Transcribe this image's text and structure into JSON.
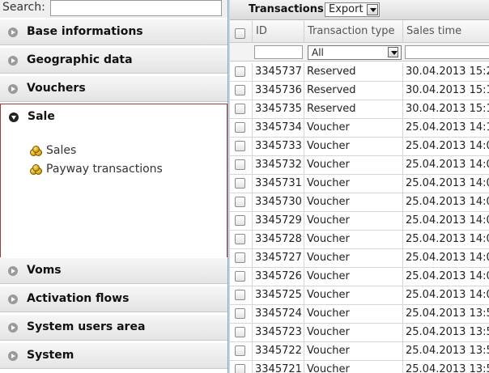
{
  "search": {
    "label": "Search:",
    "value": "",
    "placeholder": ""
  },
  "accordion": {
    "top_sections": [
      {
        "label": "Base informations"
      },
      {
        "label": "Geographic data"
      },
      {
        "label": "Vouchers"
      }
    ],
    "open_section": {
      "label": "Sale",
      "items": [
        {
          "label": "Sales",
          "icon": "coins-icon"
        },
        {
          "label": "Payway transactions",
          "icon": "coins-icon"
        }
      ]
    },
    "bottom_sections": [
      {
        "label": "Voms"
      },
      {
        "label": "Activation flows"
      },
      {
        "label": "System users area"
      },
      {
        "label": "System"
      }
    ]
  },
  "toolbar": {
    "title": "Transactions",
    "export_label": "Export"
  },
  "grid": {
    "columns": [
      "ID",
      "Transaction type",
      "Sales time"
    ],
    "filters": {
      "id": "",
      "transaction_type": "All",
      "sales_time": ""
    },
    "rows": [
      {
        "id": "3345737",
        "type": "Reserved",
        "time": "30.04.2013 15:2"
      },
      {
        "id": "3345736",
        "type": "Reserved",
        "time": "30.04.2013 15:1"
      },
      {
        "id": "3345735",
        "type": "Reserved",
        "time": "30.04.2013 15:1"
      },
      {
        "id": "3345734",
        "type": "Voucher",
        "time": "25.04.2013 14:1"
      },
      {
        "id": "3345733",
        "type": "Voucher",
        "time": "25.04.2013 14:0"
      },
      {
        "id": "3345732",
        "type": "Voucher",
        "time": "25.04.2013 14:0"
      },
      {
        "id": "3345731",
        "type": "Voucher",
        "time": "25.04.2013 14:0"
      },
      {
        "id": "3345730",
        "type": "Voucher",
        "time": "25.04.2013 14:0"
      },
      {
        "id": "3345729",
        "type": "Voucher",
        "time": "25.04.2013 14:0"
      },
      {
        "id": "3345728",
        "type": "Voucher",
        "time": "25.04.2013 14:0"
      },
      {
        "id": "3345727",
        "type": "Voucher",
        "time": "25.04.2013 14:0"
      },
      {
        "id": "3345726",
        "type": "Voucher",
        "time": "25.04.2013 14:0"
      },
      {
        "id": "3345725",
        "type": "Voucher",
        "time": "25.04.2013 14:0"
      },
      {
        "id": "3345724",
        "type": "Voucher",
        "time": "25.04.2013 13:5"
      },
      {
        "id": "3345723",
        "type": "Voucher",
        "time": "25.04.2013 13:5"
      },
      {
        "id": "3345722",
        "type": "Voucher",
        "time": "25.04.2013 13:5"
      },
      {
        "id": "3345721",
        "type": "Voucher",
        "time": "25.04.2013 13:5"
      }
    ]
  }
}
